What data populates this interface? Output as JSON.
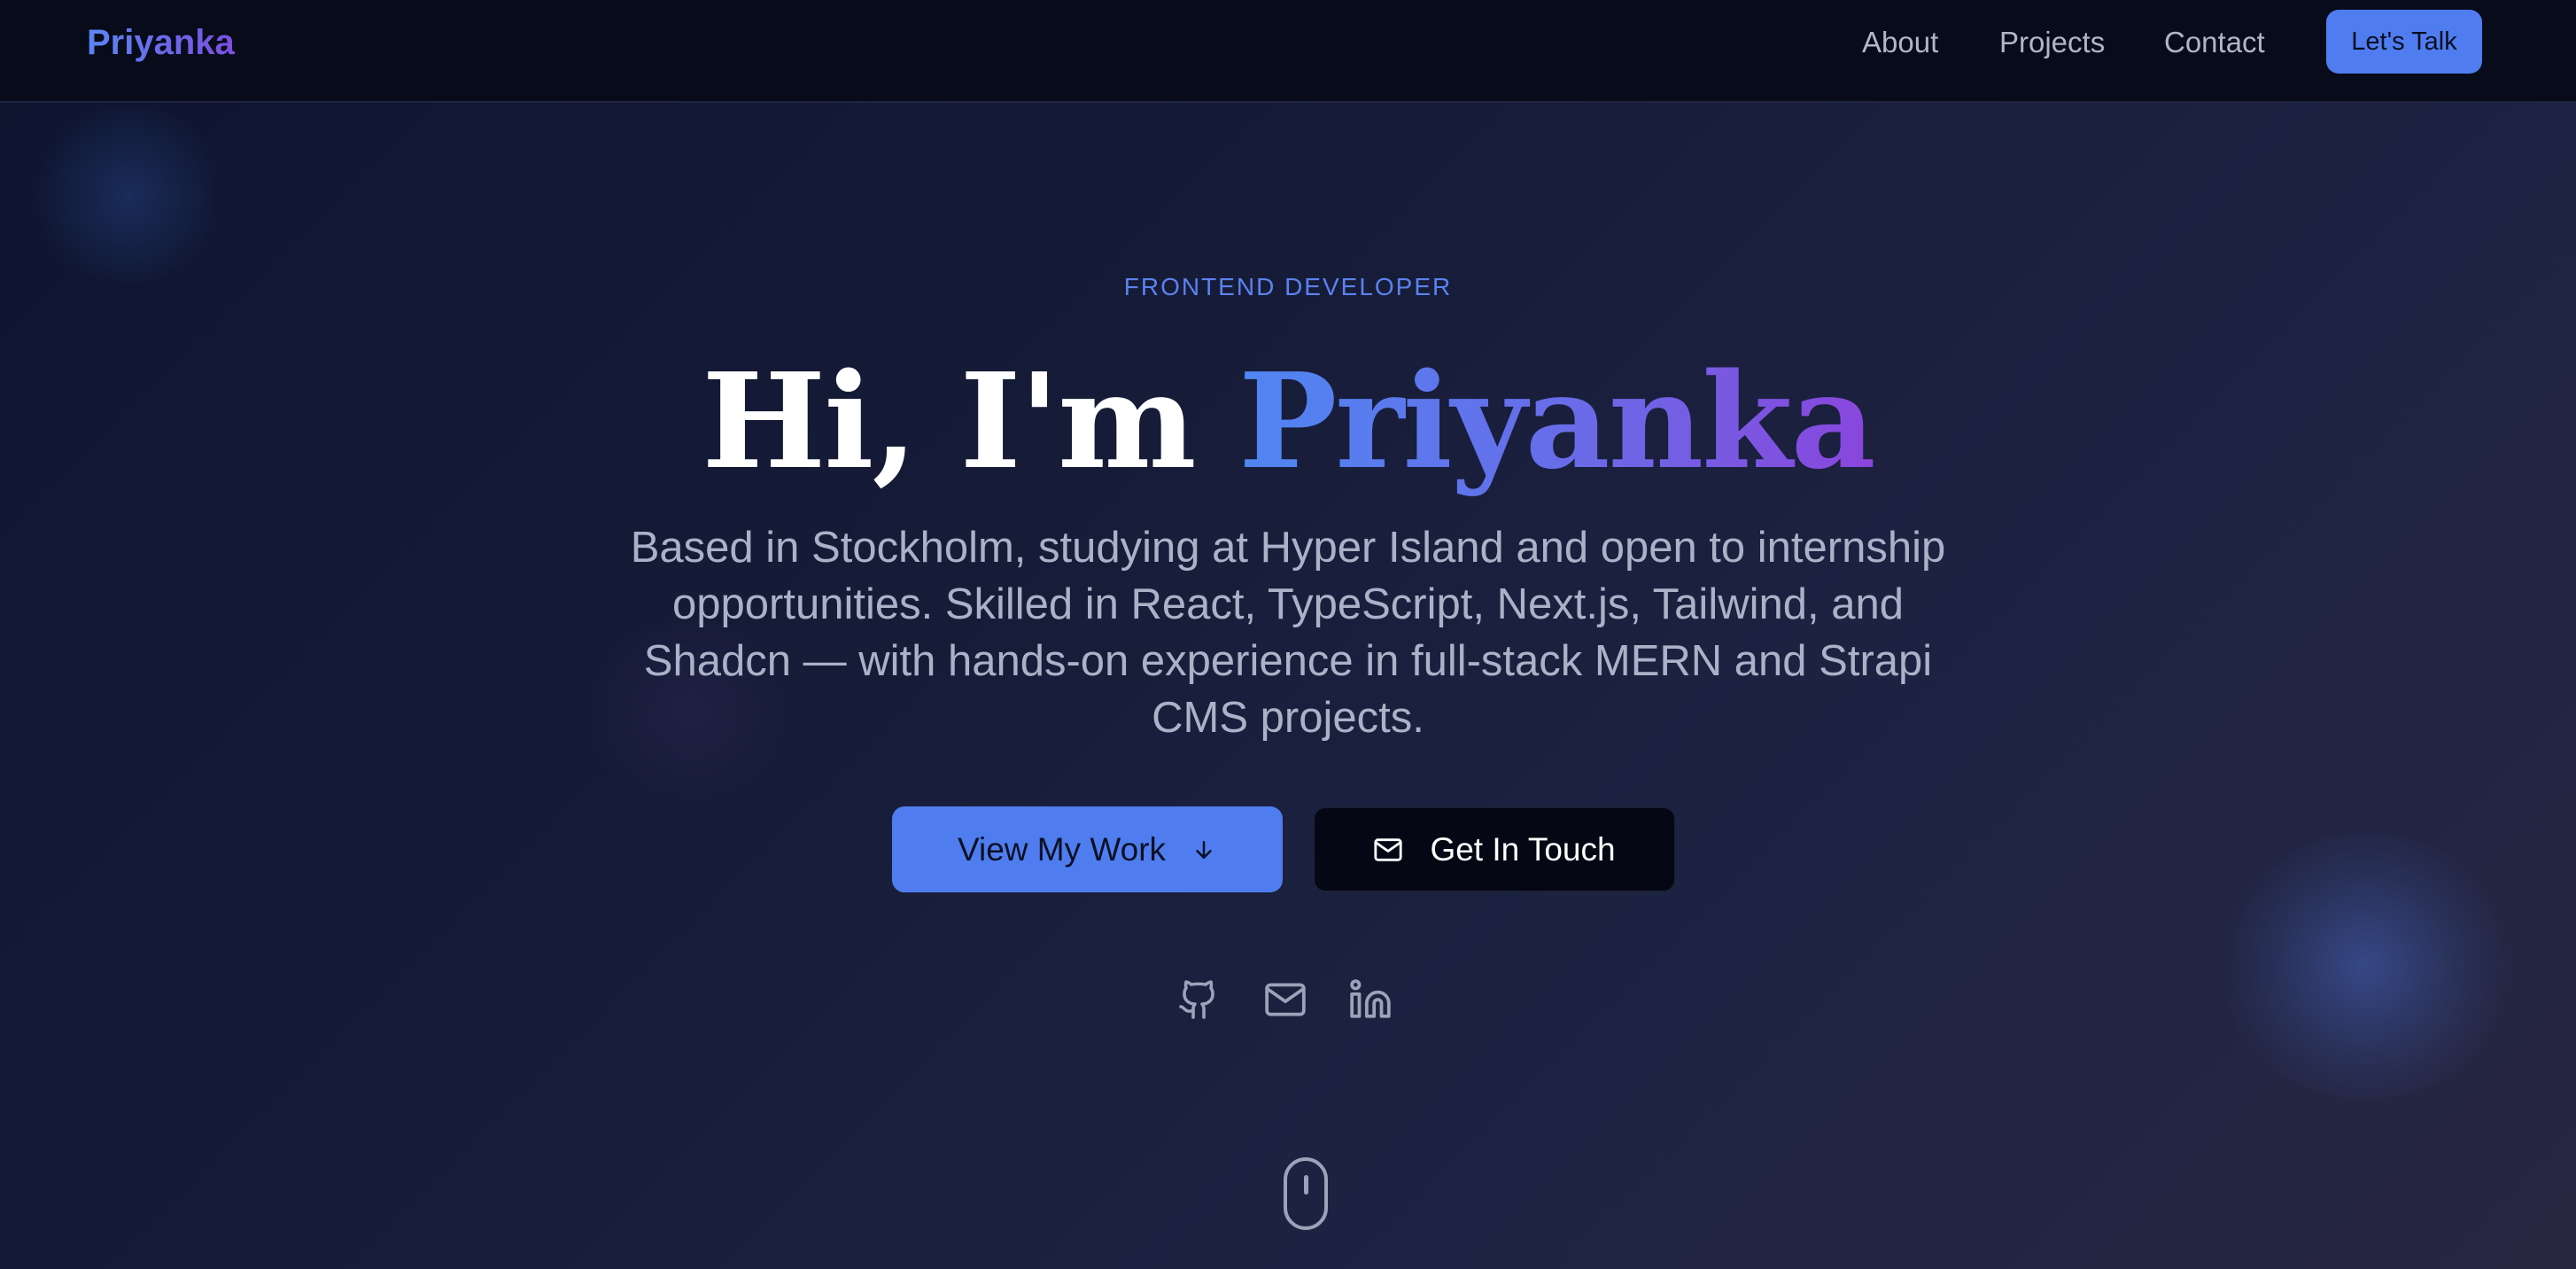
{
  "nav": {
    "logo": "Priyanka",
    "links": [
      {
        "label": "About"
      },
      {
        "label": "Projects"
      },
      {
        "label": "Contact"
      }
    ],
    "cta_label": "Let's Talk"
  },
  "hero": {
    "eyebrow": "FRONTEND DEVELOPER",
    "headline_prefix": "Hi, I'm ",
    "headline_name": "Priyanka",
    "bio": "Based in Stockholm, studying at Hyper Island and open to internship opportunities. Skilled in React, TypeScript, Next.js, Tailwind, and Shadcn — with hands-on experience in full-stack MERN and Strapi CMS projects.",
    "primary_button": {
      "label": "View My Work",
      "icon": "arrow-down-icon"
    },
    "secondary_button": {
      "label": "Get In Touch",
      "icon": "mail-icon"
    },
    "socials": [
      {
        "icon": "github-icon"
      },
      {
        "icon": "mail-icon"
      },
      {
        "icon": "linkedin-icon"
      }
    ],
    "scroll_indicator": {
      "icon": "mouse-scroll-icon"
    }
  },
  "colors": {
    "accent": "#4f7df0",
    "gradient_start": "#4f86f2",
    "gradient_end": "#8a45dc",
    "background": "#0f1428",
    "nav_background": "#070b1a",
    "muted_text": "#a9b2c6"
  }
}
